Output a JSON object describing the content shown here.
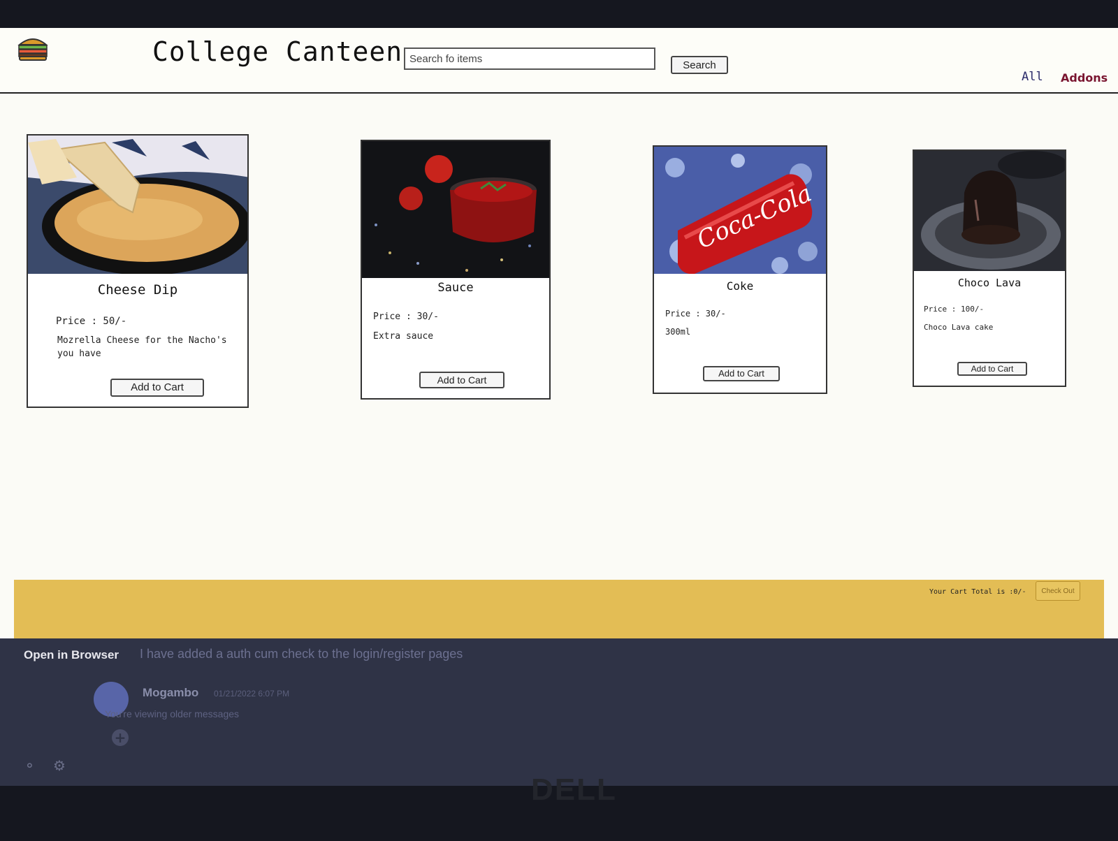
{
  "header": {
    "brand": "College Canteen",
    "search_placeholder": "Search fo items",
    "search_label": "Search",
    "nav": {
      "all": "All",
      "addons": "Addons"
    }
  },
  "cards": [
    {
      "title": "Cheese Dip",
      "price": "Price : 50/-",
      "desc": "Mozrella Cheese for the Nacho's you have",
      "button": "Add to Cart"
    },
    {
      "title": "Sauce",
      "price": "Price : 30/-",
      "desc": "Extra sauce",
      "button": "Add to Cart"
    },
    {
      "title": "Coke",
      "price": "Price : 30/-",
      "desc": "300ml",
      "button": "Add to Cart"
    },
    {
      "title": "Choco Lava",
      "price": "Price : 100/-",
      "desc": "Choco Lava cake",
      "button": "Add to Cart"
    }
  ],
  "footer": {
    "cart_total": "Your Cart Total is :0/-",
    "checkout": "Check Out"
  },
  "background_app": {
    "open_in_browser": "Open in Browser",
    "message": "I have added a auth cum check to the login/register pages",
    "username": "Mogambo",
    "timestamp": "01/21/2022 6:07 PM",
    "older_messages": "You're viewing older messages"
  },
  "device": {
    "logo": "DELL"
  },
  "colors": {
    "footer": "#e3bd55",
    "addons": "#7a1530",
    "page": "#fbfbf6"
  }
}
